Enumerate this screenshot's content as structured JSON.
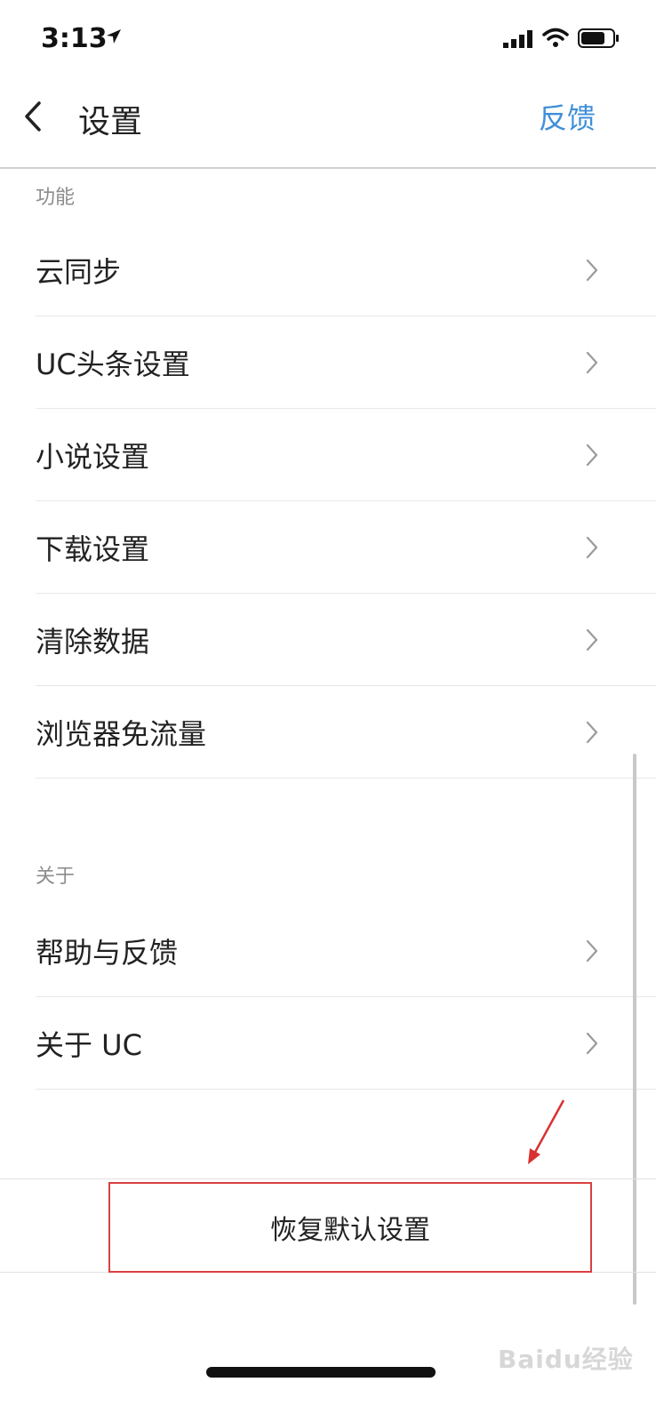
{
  "status_bar": {
    "time": "3:13"
  },
  "nav": {
    "title": "设置",
    "feedback_label": "反馈"
  },
  "sections": {
    "features": {
      "title": "功能",
      "items": [
        {
          "label": "云同步"
        },
        {
          "label": "UC头条设置"
        },
        {
          "label": "小说设置"
        },
        {
          "label": "下载设置"
        },
        {
          "label": "清除数据"
        },
        {
          "label": "浏览器免流量"
        }
      ]
    },
    "about": {
      "title": "关于",
      "items": [
        {
          "label": "帮助与反馈"
        },
        {
          "label": "关于 UC"
        }
      ]
    }
  },
  "restore": {
    "label": "恢复默认设置"
  },
  "watermark": {
    "text": "Baidu经验"
  },
  "colors": {
    "accent": "#3f8fd8",
    "highlight": "#d94040"
  },
  "icons": [
    "location-arrow-icon",
    "signal-icon",
    "wifi-icon",
    "battery-icon",
    "back-chevron-icon",
    "chevron-right-icon",
    "annotation-arrow-icon"
  ]
}
